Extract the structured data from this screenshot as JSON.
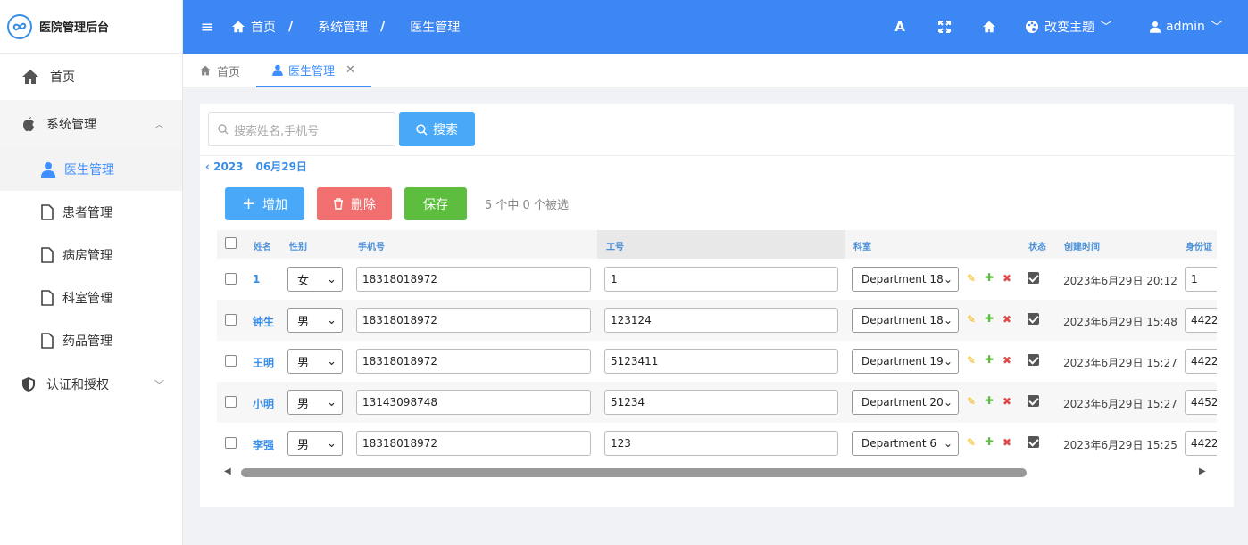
{
  "app": {
    "title": "医院管理后台"
  },
  "sidebar": {
    "items": [
      {
        "label": "首页"
      },
      {
        "label": "系统管理"
      },
      {
        "label": "医生管理"
      },
      {
        "label": "患者管理"
      },
      {
        "label": "病房管理"
      },
      {
        "label": "科室管理"
      },
      {
        "label": "药品管理"
      },
      {
        "label": "认证和授权"
      }
    ]
  },
  "header": {
    "breadcrumb": [
      "首页",
      "系统管理",
      "医生管理"
    ],
    "separator": "/",
    "font_button": "A",
    "theme_label": "改变主题",
    "user_label": "admin"
  },
  "tabs": [
    {
      "label": "首页"
    },
    {
      "label": "医生管理"
    }
  ],
  "search": {
    "placeholder": "搜索姓名,手机号",
    "button_label": "搜索"
  },
  "date_nav": {
    "prev_label": "‹ 2023",
    "current_label": "06月29日"
  },
  "toolbar": {
    "add_label": "增加",
    "delete_label": "删除",
    "save_label": "保存",
    "selection_text": "5 个中 0 个被选"
  },
  "table": {
    "columns": [
      "姓名",
      "性别",
      "手机号",
      "工号",
      "科室",
      "状态",
      "创建时间",
      "身份证"
    ],
    "rows": [
      {
        "name": "1",
        "gender": "女",
        "phone": "18318018972",
        "job_no": "1",
        "department": "Department 18",
        "status": true,
        "created": "2023年6月29日 20:12",
        "id_card": "1"
      },
      {
        "name": "钟生",
        "gender": "男",
        "phone": "18318018972",
        "job_no": "123124",
        "department": "Department 18",
        "status": true,
        "created": "2023年6月29日 15:48",
        "id_card": "4422"
      },
      {
        "name": "王明",
        "gender": "男",
        "phone": "18318018972",
        "job_no": "5123411",
        "department": "Department 19",
        "status": true,
        "created": "2023年6月29日 15:27",
        "id_card": "4422"
      },
      {
        "name": "小明",
        "gender": "男",
        "phone": "13143098748",
        "job_no": "51234",
        "department": "Department 20",
        "status": true,
        "created": "2023年6月29日 15:27",
        "id_card": "4452"
      },
      {
        "name": "李强",
        "gender": "男",
        "phone": "18318018972",
        "job_no": "123",
        "department": "Department 6",
        "status": true,
        "created": "2023年6月29日 15:25",
        "id_card": "4422"
      }
    ]
  },
  "colors": {
    "primary": "#3d87f5",
    "link": "#3a8ee6",
    "add": "#4aa8f8",
    "delete": "#f26f6f",
    "save": "#5cbd3e",
    "edit_icon": "#f0b400",
    "add_icon": "#5cbd3e",
    "remove_icon": "#e04848"
  }
}
